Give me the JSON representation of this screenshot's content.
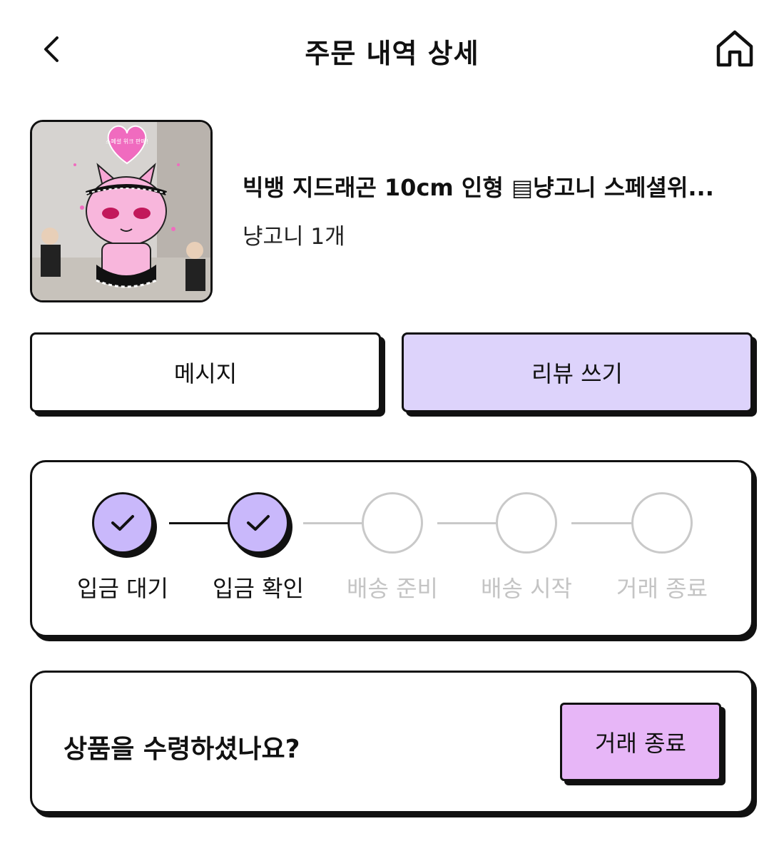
{
  "header": {
    "title": "주문 내역 상세",
    "back_icon": "chevron-left-icon",
    "home_icon": "home-icon"
  },
  "product": {
    "name": "빅뱅 지드래곤 10cm 인형 ▤냥고니 스페셜위...",
    "option": "냥고니 1개",
    "image_text": "스페셜 위크 판매!"
  },
  "actions": {
    "message_label": "메시지",
    "review_label": "리뷰 쓰기"
  },
  "progress": {
    "steps": [
      {
        "label": "입금 대기",
        "done": true
      },
      {
        "label": "입금 확인",
        "done": true
      },
      {
        "label": "배송 준비",
        "done": false
      },
      {
        "label": "배송 시작",
        "done": false
      },
      {
        "label": "거래 종료",
        "done": false
      }
    ]
  },
  "receive": {
    "question": "상품을 수령하셨나요?",
    "finish_label": "거래 종료"
  },
  "colors": {
    "accent_lavender": "#ddd3fb",
    "step_done": "#c9b8fb",
    "finish_pink": "#e7b6f7",
    "inactive_gray": "#c4c4c4"
  }
}
